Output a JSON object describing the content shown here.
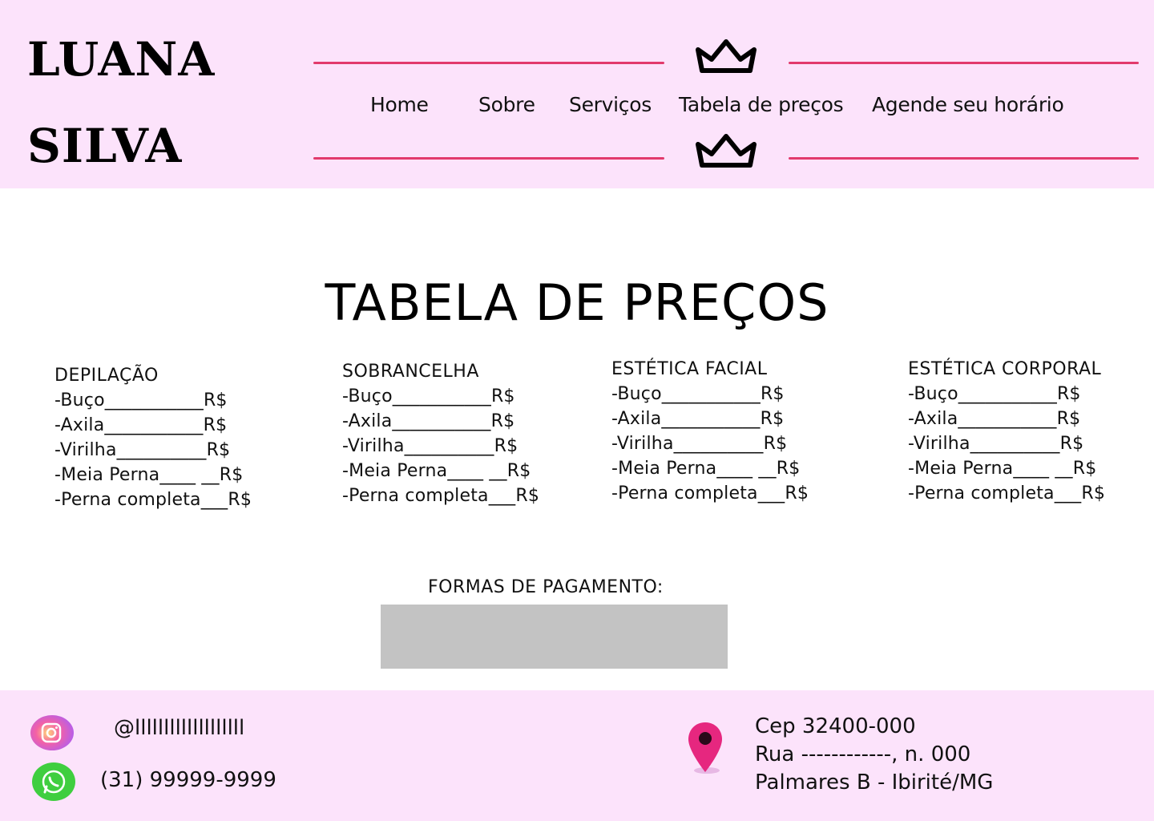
{
  "brand": {
    "line1": "LUANA",
    "line2": "SILVA"
  },
  "colors": {
    "header_bg": "#fce3fb",
    "accent_line": "#e23a6c",
    "footer_bg": "#fce3fb",
    "payment_box": "#c3c3c3"
  },
  "nav": {
    "items": [
      "Home",
      "Sobre",
      "Serviços",
      "Tabela de preços",
      "Agende seu horário"
    ]
  },
  "page_title": "TABELA DE PREÇOS",
  "price_sections": [
    {
      "title": "DEPILAÇÃO",
      "lines": [
        "-Buço___________R$",
        "-Axila___________R$",
        "-Virilha__________R$",
        "-Meia Perna____ __R$",
        "-Perna completa___R$"
      ]
    },
    {
      "title": "SOBRANCELHA",
      "lines": [
        "-Buço___________R$",
        "-Axila___________R$",
        "-Virilha__________R$",
        "-Meia Perna____ __R$",
        "-Perna completa___R$"
      ]
    },
    {
      "title": "ESTÉTICA FACIAL",
      "lines": [
        "-Buço___________R$",
        "-Axila___________R$",
        "-Virilha__________R$",
        "-Meia Perna____ __R$",
        "-Perna completa___R$"
      ]
    },
    {
      "title": "ESTÉTICA CORPORAL",
      "lines": [
        "-Buço___________R$",
        "-Axila___________R$",
        "-Virilha__________R$",
        "-Meia Perna____ __R$",
        "-Perna completa___R$"
      ]
    }
  ],
  "payment": {
    "label": "FORMAS DE PAGAMENTO:"
  },
  "footer": {
    "instagram_handle": "@lllllllllllllllllll",
    "phone": "(31) 99999-9999",
    "address": [
      "Cep 32400-000",
      "Rua ------------, n. 000",
      "Palmares B - Ibirité/MG"
    ],
    "icons": [
      "instagram-icon",
      "whatsapp-icon",
      "location-pin-icon",
      "crown-icon"
    ]
  }
}
